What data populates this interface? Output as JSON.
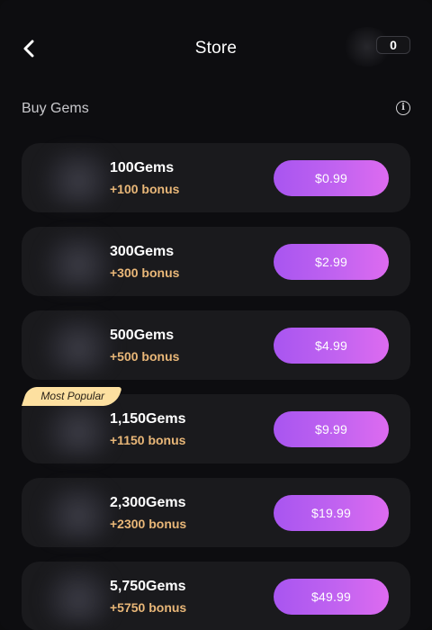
{
  "header": {
    "title": "Store",
    "back_icon": "chevron-left-icon",
    "balance": "0"
  },
  "section": {
    "title": "Buy Gems",
    "info_icon": "info-icon"
  },
  "packages": [
    {
      "name": "100Gems",
      "bonus": "+100 bonus",
      "price": "$0.99",
      "badge": ""
    },
    {
      "name": "300Gems",
      "bonus": "+300 bonus",
      "price": "$2.99",
      "badge": ""
    },
    {
      "name": "500Gems",
      "bonus": "+500 bonus",
      "price": "$4.99",
      "badge": ""
    },
    {
      "name": "1,150Gems",
      "bonus": "+1150 bonus",
      "price": "$9.99",
      "badge": "Most Popular"
    },
    {
      "name": "2,300Gems",
      "bonus": "+2300 bonus",
      "price": "$19.99",
      "badge": ""
    },
    {
      "name": "5,750Gems",
      "bonus": "+5750 bonus",
      "price": "$49.99",
      "badge": ""
    }
  ],
  "colors": {
    "background": "#0d0d10",
    "card": "#1a1a1d",
    "bonus_text": "#e9b778",
    "button_start": "#a855f0",
    "button_end": "#dd6bf0",
    "badge": "#fde0a0"
  }
}
